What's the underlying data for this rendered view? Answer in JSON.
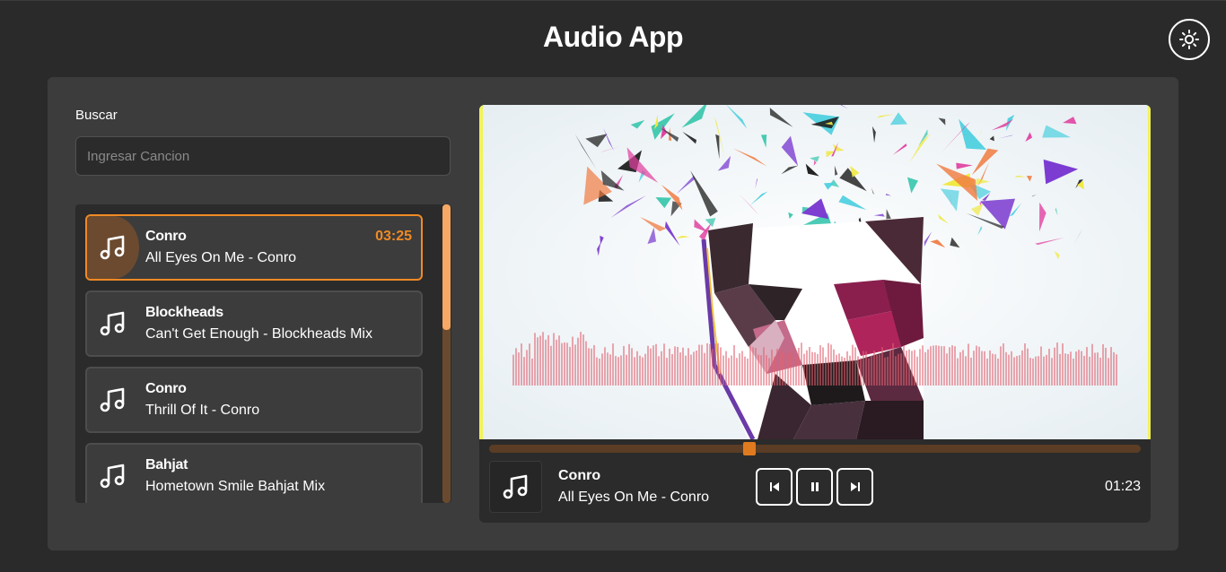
{
  "header": {
    "title": "Audio App",
    "theme_toggle_icon": "sun-icon"
  },
  "search": {
    "label": "Buscar",
    "placeholder": "Ingresar Cancion",
    "value": ""
  },
  "songs": [
    {
      "artist": "Conro",
      "title": "All Eyes On Me - Conro",
      "duration": "03:25",
      "active": true,
      "icon": "music-note-icon"
    },
    {
      "artist": "Blockheads",
      "title": "Can't Get Enough - Blockheads Mix",
      "active": false,
      "icon": "music-note-icon"
    },
    {
      "artist": "Conro",
      "title": "Thrill Of It - Conro",
      "active": false,
      "icon": "music-note-icon"
    },
    {
      "artist": "Bahjat",
      "title": "Hometown Smile Bahjat Mix",
      "active": false,
      "icon": "music-note-icon"
    }
  ],
  "player": {
    "artist": "Conro",
    "title": "All Eyes On Me - Conro",
    "current_time": "01:23",
    "progress": 0.4,
    "controls": {
      "previous_icon": "skip-previous-icon",
      "pause_icon": "pause-icon",
      "next_icon": "skip-next-icon"
    }
  },
  "colors": {
    "accent": "#f08a24",
    "background": "#2a2a2a",
    "panel": "#3c3c3c",
    "list_background": "#2b2b2b"
  }
}
